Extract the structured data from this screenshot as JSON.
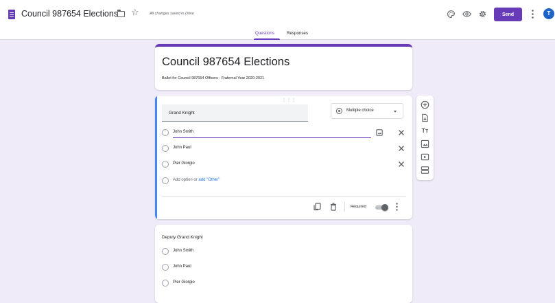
{
  "header": {
    "doc_title": "Council 987654 Elections",
    "save_status": "All changes saved in Drive",
    "send_label": "Send",
    "avatar_initial": "T",
    "icons": [
      "forms-doc-icon",
      "folder-icon",
      "star-icon",
      "palette-icon",
      "eye-icon",
      "settings-icon",
      "more-vert-icon"
    ]
  },
  "tabs": {
    "questions_label": "Questions",
    "responses_label": "Responses",
    "active": "Questions"
  },
  "form": {
    "title": "Council 987654 Elections",
    "description": "Ballot for Council 987654 Officers - Fraternal Year 2020-2021"
  },
  "question1": {
    "title": "Grand Knight",
    "type": "Multiple choice",
    "options": [
      "John Smith",
      "John Paul",
      "Pier Giorgio"
    ],
    "add_option": "Add option",
    "or": "or",
    "add_other": "add \"Other\"",
    "required_label": "Required",
    "required": false
  },
  "question2": {
    "title": "Deputy Grand Knight",
    "options": [
      "John Smith",
      "John Paul",
      "Pier Giorgio"
    ]
  },
  "toolbar": {
    "icons": [
      "add-question-icon",
      "import-questions-icon",
      "add-title-icon",
      "add-image-icon",
      "add-video-icon",
      "add-section-icon"
    ]
  },
  "colors": {
    "accent": "#673ab7",
    "background": "#f0ebf8",
    "active_card_bar": "#4285f4",
    "link": "#1a73e8",
    "avatar": "#1e63c6"
  }
}
